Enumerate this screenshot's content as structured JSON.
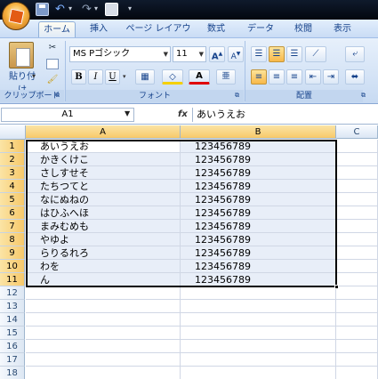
{
  "ribbon_tabs": [
    "ホーム",
    "挿入",
    "ページ レイアウト",
    "数式",
    "データ",
    "校閲",
    "表示"
  ],
  "clipboard": {
    "paste_label": "貼り付け",
    "group_label": "クリップボード"
  },
  "font": {
    "name": "MS Pゴシック",
    "size": "11",
    "bold": "B",
    "italic": "I",
    "underline": "U",
    "color_button": "A",
    "group_label": "フォント"
  },
  "alignment": {
    "group_label": "配置"
  },
  "formula_bar": {
    "name_box": "A1",
    "fx": "fx",
    "value": "あいうえお"
  },
  "columns": [
    "A",
    "B",
    "C"
  ],
  "rows": [
    "1",
    "2",
    "3",
    "4",
    "5",
    "6",
    "7",
    "8",
    "9",
    "10",
    "11",
    "12",
    "13",
    "14",
    "15",
    "16",
    "17",
    "18"
  ],
  "cells": [
    {
      "a": "あいうえお",
      "b": "123456789"
    },
    {
      "a": "かきくけこ",
      "b": "123456789"
    },
    {
      "a": "さしすせそ",
      "b": "123456789"
    },
    {
      "a": "たちつてと",
      "b": "123456789"
    },
    {
      "a": "なにぬねの",
      "b": "123456789"
    },
    {
      "a": "はひふへほ",
      "b": "123456789"
    },
    {
      "a": "まみむめも",
      "b": "123456789"
    },
    {
      "a": "やゆよ",
      "b": "123456789"
    },
    {
      "a": "らりるれろ",
      "b": "123456789"
    },
    {
      "a": "わを",
      "b": "123456789"
    },
    {
      "a": "ん",
      "b": "123456789"
    }
  ],
  "colors": {
    "accent": "#f7c96a",
    "ribbon": "#c7daf2",
    "selection": "#e8eef8"
  }
}
